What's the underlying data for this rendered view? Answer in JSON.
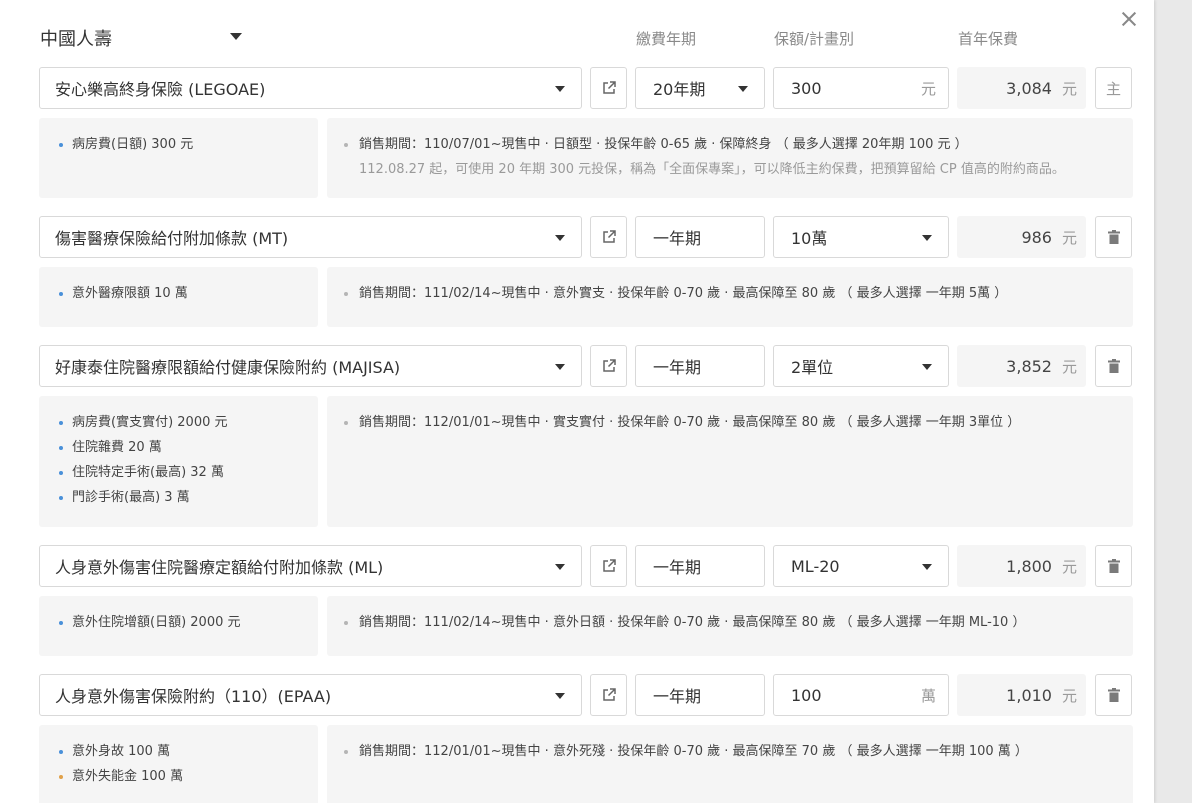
{
  "header": {
    "company": "中國人壽",
    "col_term": "繳費年期",
    "col_amount": "保額/計畫別",
    "col_premium": "首年保費"
  },
  "icons": {
    "close": "close-icon",
    "external": "external-link-icon",
    "trash": "trash-icon",
    "caret": "caret-down-icon"
  },
  "plans": [
    {
      "name": "安心樂高終身保險 (LEGOAE)",
      "term": "20年期",
      "amount": "300",
      "amount_unit": "元",
      "premium": "3,084",
      "premium_unit": "元",
      "action_label": "主",
      "benefits": [
        "病房費(日額) 300 元"
      ],
      "info": "銷售期間：110/07/01~現售中 · 日額型 · 投保年齡 0-65 歲 · 保障終身 （ 最多人選擇 20年期 100 元 ）",
      "note": "112.08.27 起，可使用 20 年期 300 元投保，稱為「全面保專案」，可以降低主約保費，把預算留給 CP 值高的附約商品。"
    },
    {
      "name": "傷害醫療保險給付附加條款 (MT)",
      "term": "一年期",
      "amount": "10萬",
      "premium": "986",
      "premium_unit": "元",
      "benefits": [
        "意外醫療限額 10 萬"
      ],
      "info": "銷售期間：111/02/14~現售中 · 意外實支 · 投保年齡 0-70 歲 · 最高保障至 80 歲 （ 最多人選擇 一年期 5萬 ）"
    },
    {
      "name": "好康泰住院醫療限額給付健康保險附約 (MAJISA)",
      "term": "一年期",
      "amount": "2單位",
      "premium": "3,852",
      "premium_unit": "元",
      "benefits": [
        "病房費(實支實付) 2000 元",
        "住院雜費 20 萬",
        "住院特定手術(最高) 32 萬",
        "門診手術(最高) 3 萬"
      ],
      "info": "銷售期間：112/01/01~現售中 · 實支實付 · 投保年齡 0-70 歲 · 最高保障至 80 歲 （ 最多人選擇 一年期 3單位 ）"
    },
    {
      "name": "人身意外傷害住院醫療定額給付附加條款 (ML)",
      "term": "一年期",
      "amount": "ML-20",
      "premium": "1,800",
      "premium_unit": "元",
      "benefits": [
        "意外住院增額(日額) 2000 元"
      ],
      "info": "銷售期間：111/02/14~現售中 · 意外日額 · 投保年齡 0-70 歲 · 最高保障至 80 歲 （ 最多人選擇 一年期 ML-10 ）"
    },
    {
      "name": "人身意外傷害保險附約（110）(EPAA)",
      "term": "一年期",
      "amount": "100",
      "amount_unit": "萬",
      "premium": "1,010",
      "premium_unit": "元",
      "benefits": [
        "意外身故 100 萬",
        "意外失能金 100 萬"
      ],
      "info": "銷售期間：112/01/01~現售中 · 意外死殘 · 投保年齡 0-70 歲 · 最高保障至 70 歲 （ 最多人選擇 一年期 100 萬 ）"
    }
  ]
}
